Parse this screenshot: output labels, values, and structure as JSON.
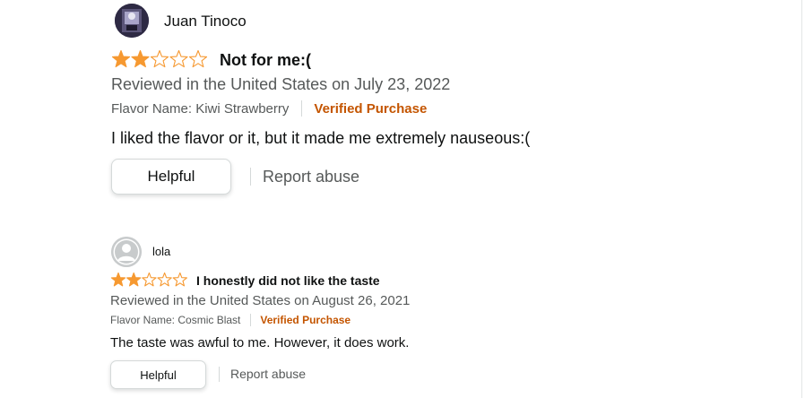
{
  "colors": {
    "star": "#f69931",
    "verified": "#c45500",
    "meta_text": "#565959",
    "border": "#d5d9d9"
  },
  "reviews": [
    {
      "reviewer_name": "Juan Tinoco",
      "avatar": "profile-photo",
      "rating": 2,
      "rating_max": 5,
      "title": "Not for me:(",
      "reviewed_line": "Reviewed in the United States on July 23, 2022",
      "flavor": "Flavor Name: Kiwi Strawberry",
      "verified": "Verified Purchase",
      "body": "I liked the flavor or it, but it made me extremely nauseous:(",
      "helpful_label": "Helpful",
      "report_label": "Report abuse"
    },
    {
      "reviewer_name": "lola",
      "avatar": "default-avatar-icon",
      "rating": 2,
      "rating_max": 5,
      "title": "I honestly did not like the taste",
      "reviewed_line": "Reviewed in the United States on August 26, 2021",
      "flavor": "Flavor Name: Cosmic Blast",
      "verified": "Verified Purchase",
      "body": "The taste was awful to me. However, it does work.",
      "helpful_label": "Helpful",
      "report_label": "Report abuse"
    }
  ]
}
